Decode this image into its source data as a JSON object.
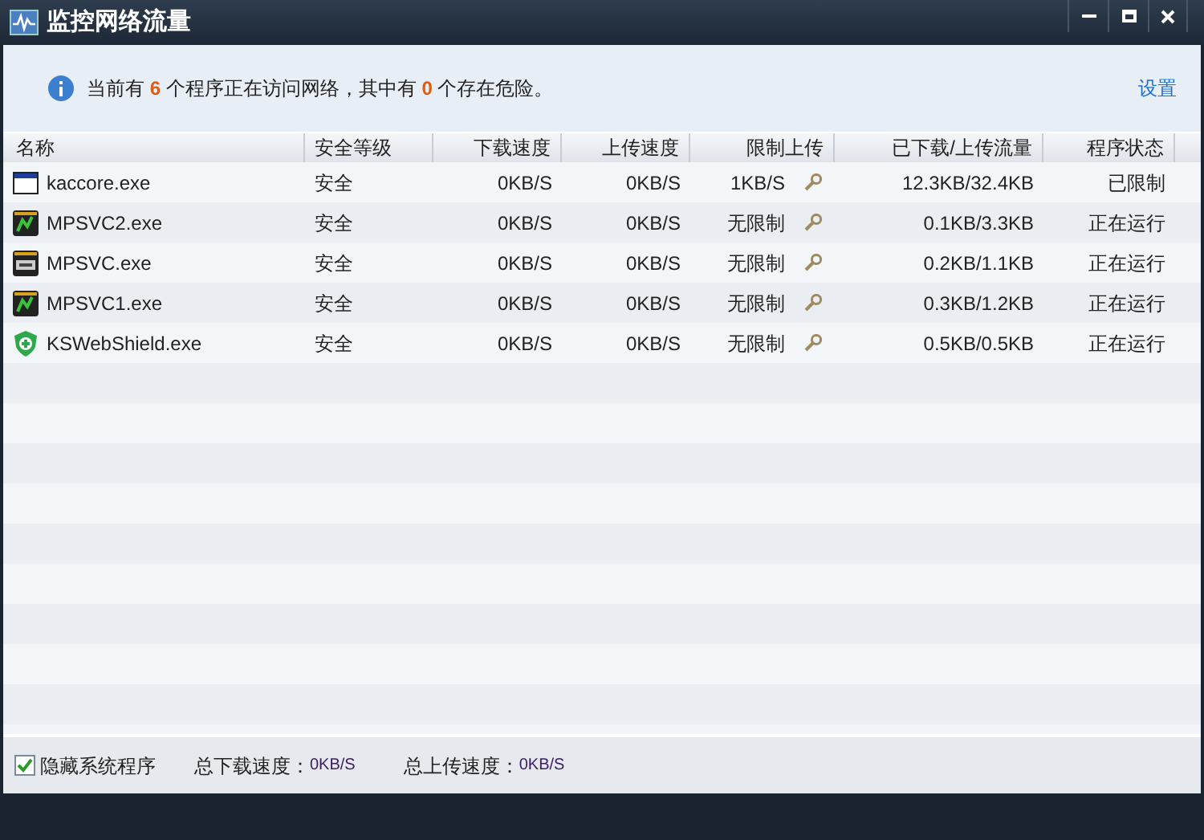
{
  "window": {
    "title": "监控网络流量"
  },
  "summary": {
    "parts": [
      {
        "kind": "text",
        "text": "当前有 "
      },
      {
        "kind": "number",
        "text": "6"
      },
      {
        "kind": "text",
        "text": " 个程序正在访问网络，其中有 "
      },
      {
        "kind": "number",
        "text": "0"
      },
      {
        "kind": "text",
        "text": " 个存在危险。"
      }
    ]
  },
  "settings_link": "设置",
  "table": {
    "columns": [
      "名称",
      "安全等级",
      "下载速度",
      "上传速度",
      "限制上传",
      "已下载/上传流量",
      "程序状态"
    ],
    "rows": [
      {
        "kind": "window",
        "name": "kaccore.exe",
        "safety": "安全",
        "download": "0KB/S",
        "upload": "0KB/S",
        "limit": "1KB/S",
        "traffic": "12.3KB/32.4KB",
        "status": "已限制"
      },
      {
        "kind": "app",
        "name": "MPSVC2.exe",
        "safety": "安全",
        "download": "0KB/S",
        "upload": "0KB/S",
        "limit": "无限制",
        "traffic": "0.1KB/3.3KB",
        "status": "正在运行"
      },
      {
        "kind": "console",
        "name": "MPSVC.exe",
        "safety": "安全",
        "download": "0KB/S",
        "upload": "0KB/S",
        "limit": "无限制",
        "traffic": "0.2KB/1.1KB",
        "status": "正在运行"
      },
      {
        "kind": "app",
        "name": "MPSVC1.exe",
        "safety": "安全",
        "download": "0KB/S",
        "upload": "0KB/S",
        "limit": "无限制",
        "traffic": "0.3KB/1.2KB",
        "status": "正在运行"
      },
      {
        "kind": "shield",
        "name": "KSWebShield.exe",
        "safety": "安全",
        "download": "0KB/S",
        "upload": "0KB/S",
        "limit": "无限制",
        "traffic": "0.5KB/0.5KB",
        "status": "正在运行"
      }
    ]
  },
  "footer": {
    "hide_system": {
      "label": "隐藏系统程序",
      "checked": true
    },
    "total_download": {
      "label": "总下载速度：",
      "value": "0KB/S"
    },
    "total_upload": {
      "label": "总上传速度：",
      "value": "0KB/S"
    }
  }
}
